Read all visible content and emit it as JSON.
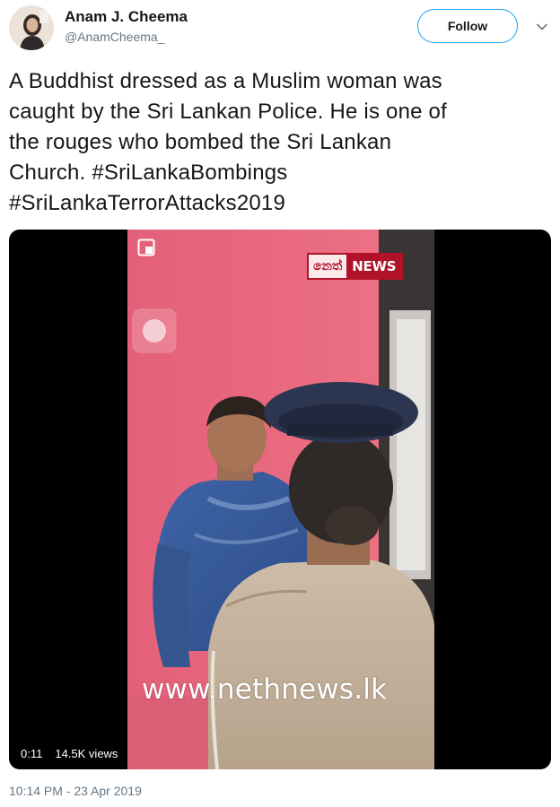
{
  "author": {
    "display_name": "Anam J. Cheema",
    "handle": "@AnamCheema_",
    "avatar_icon": "profile-photo"
  },
  "actions": {
    "follow_label": "Follow",
    "more_icon": "chevron-down-icon"
  },
  "tweet": {
    "lines": [
      "A Buddhist dressed as a Muslim woman was",
      "caught by the Sri Lankan Police. He is one of",
      "the rouges who bombed the Sri Lankan"
    ],
    "line4_text": "Church. ",
    "hashtag_1": "#SriLankaBombings",
    "hashtag_2": "#SriLankaTerrorAttacks2019"
  },
  "video": {
    "channel_logo_left": "නෙත්",
    "channel_logo_right": "NEWS",
    "watermark": "www.nethnews.lk",
    "duration": "0:11",
    "views": "14.5K views"
  },
  "timestamp": "10:14 PM - 23 Apr 2019",
  "colors": {
    "accent": "#1da1f2",
    "text_primary": "#14171a",
    "text_secondary": "#657786",
    "wall_pink": "#e8697c",
    "logo_red": "#b0122a"
  }
}
